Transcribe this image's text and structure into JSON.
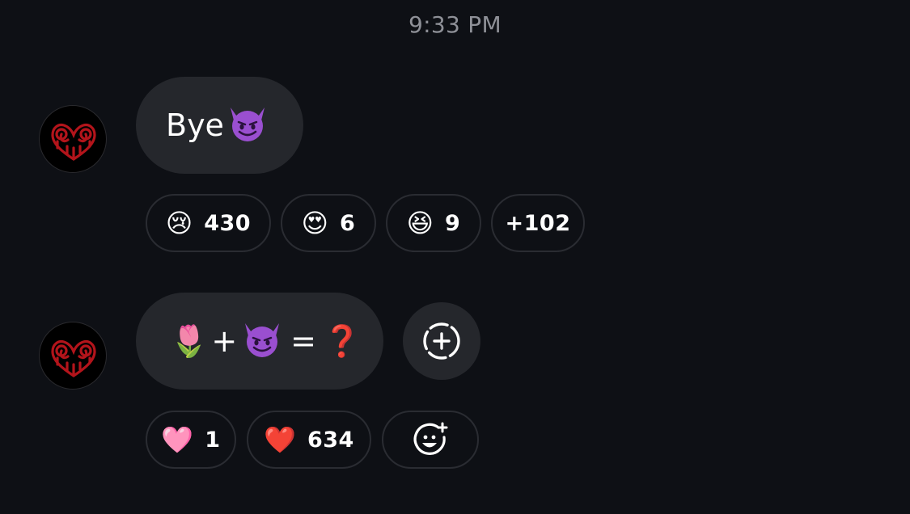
{
  "timestamp": "9:33 PM",
  "messages": [
    {
      "text": "Bye",
      "emoji": "devil-emoji",
      "reactions": [
        {
          "emoji": "😢",
          "icon": "crying-face-icon",
          "count": "430"
        },
        {
          "emoji": "😍",
          "icon": "heart-eyes-face-icon",
          "count": "6"
        },
        {
          "emoji": "😆",
          "icon": "laughing-face-icon",
          "count": "9"
        }
      ],
      "more_reactions": "+102"
    },
    {
      "parts": [
        "🌷",
        "+",
        "😈",
        "=",
        "❓"
      ],
      "reactions": [
        {
          "emoji": "🩷",
          "icon": "pink-heart-icon",
          "count": "1"
        },
        {
          "emoji": "❤️",
          "icon": "red-heart-icon",
          "count": "634"
        }
      ]
    }
  ],
  "colors": {
    "background": "#0e1015",
    "bubble": "#25272c",
    "pill_border": "#2a2c32",
    "timestamp": "#8e9097"
  }
}
